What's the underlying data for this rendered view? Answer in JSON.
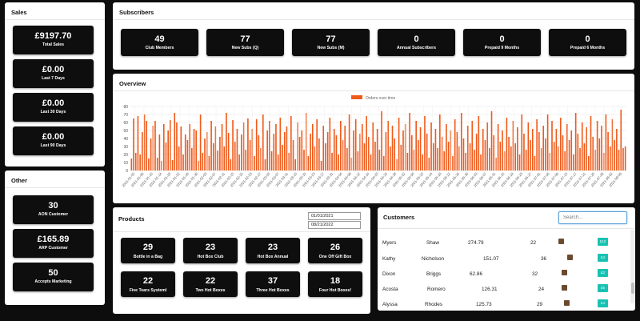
{
  "sales": {
    "title": "Sales",
    "stats": [
      {
        "value": "£9197.70",
        "label": "Total Sales"
      },
      {
        "value": "£0.00",
        "label": "Last 7 Days"
      },
      {
        "value": "£0.00",
        "label": "Last 30 Days"
      },
      {
        "value": "£0.00",
        "label": "Last 90 Days"
      }
    ]
  },
  "other": {
    "title": "Other",
    "stats": [
      {
        "value": "30",
        "label": "AON Customer"
      },
      {
        "value": "£165.89",
        "label": "ARP Customer"
      },
      {
        "value": "50",
        "label": "Accepts Marketing"
      }
    ]
  },
  "subscribers": {
    "title": "Subscribers",
    "stats": [
      {
        "value": "49",
        "label": "Club Members"
      },
      {
        "value": "77",
        "label": "New Subs (Q)"
      },
      {
        "value": "77",
        "label": "New Subs (M)"
      },
      {
        "value": "0",
        "label": "Annual Subscribers"
      },
      {
        "value": "0",
        "label": "Prepaid 9 Months"
      },
      {
        "value": "0",
        "label": "Prepaid 6 Months"
      }
    ]
  },
  "overview": {
    "title": "Overview",
    "legend_label": "Orders over time",
    "bar_color": "#f05a1a"
  },
  "chart_data": {
    "type": "bar",
    "title": "",
    "series_name": "Orders over time",
    "ylim": [
      0,
      80
    ],
    "yticks": [
      0,
      10,
      20,
      30,
      40,
      50,
      60,
      70,
      80
    ],
    "grid": true,
    "legend_position": "top-center",
    "xtick_labels": [
      "2021-01-02",
      "2021-01-06",
      "2021-01-10",
      "2021-01-14",
      "2021-01-18",
      "2021-01-22",
      "2021-01-26",
      "2021-01-30",
      "2021-02-03",
      "2021-02-07",
      "2021-02-11",
      "2021-02-15",
      "2021-02-19",
      "2021-02-23",
      "2021-02-27",
      "2021-03-03",
      "2021-03-07",
      "2021-03-11",
      "2021-03-15",
      "2021-03-19",
      "2021-03-23",
      "2021-03-27",
      "2021-03-31",
      "2021-04-04",
      "2021-04-08",
      "2021-04-12",
      "2021-04-16",
      "2021-04-20",
      "2021-04-24",
      "2021-04-28",
      "2021-05-02",
      "2021-05-06",
      "2021-05-10",
      "2021-05-14",
      "2021-05-18",
      "2021-05-22",
      "2021-05-26",
      "2021-05-30",
      "2021-06-03",
      "2021-06-07",
      "2021-06-11",
      "2021-06-15",
      "2021-06-19",
      "2021-06-23",
      "2021-06-27",
      "2021-07-01",
      "2021-07-05",
      "2021-07-09",
      "2021-07-13",
      "2021-07-17",
      "2021-07-21",
      "2021-07-25",
      "2021-07-29",
      "2021-08-02",
      "2021-08-06"
    ],
    "values": [
      15,
      65,
      22,
      68,
      20,
      48,
      70,
      62,
      15,
      40,
      56,
      62,
      16,
      45,
      12,
      58,
      35,
      50,
      63,
      13,
      72,
      60,
      30,
      55,
      20,
      45,
      38,
      58,
      28,
      52,
      50,
      12,
      70,
      22,
      40,
      48,
      18,
      62,
      34,
      55,
      25,
      42,
      58,
      30,
      72,
      47,
      14,
      63,
      36,
      52,
      20,
      45,
      60,
      26,
      65,
      38,
      52,
      18,
      64,
      44,
      28,
      70,
      14,
      50,
      62,
      24,
      46,
      58,
      20,
      66,
      32,
      48,
      55,
      22,
      68,
      38,
      14,
      60,
      42,
      50,
      26,
      72,
      18,
      46,
      58,
      30,
      64,
      40,
      12,
      56,
      34,
      48,
      66,
      22,
      52,
      44,
      20,
      62,
      38,
      56,
      28,
      70,
      16,
      50,
      64,
      24,
      46,
      58,
      34,
      68,
      42,
      20,
      60,
      36,
      52,
      26,
      74,
      18,
      48,
      62,
      30,
      56,
      40,
      14,
      66,
      32,
      50,
      58,
      22,
      72,
      44,
      26,
      62,
      38,
      54,
      20,
      68,
      46,
      16,
      60,
      34,
      52,
      28,
      70,
      42,
      24,
      58,
      36,
      50,
      18,
      64,
      48,
      30,
      72,
      40,
      22,
      56,
      34,
      62,
      26,
      46,
      68,
      20,
      52,
      38,
      60,
      28,
      74,
      44,
      16,
      58,
      36,
      50,
      24,
      66,
      42,
      30,
      62,
      34,
      54,
      20,
      70,
      46,
      26,
      60,
      38,
      52,
      18,
      64,
      48,
      28,
      56,
      40,
      70,
      22,
      62,
      36,
      52,
      30,
      66,
      44,
      24,
      58,
      38,
      50,
      20,
      72,
      46,
      28,
      60,
      34,
      54,
      18,
      68,
      42,
      26,
      62,
      40,
      56,
      22,
      70,
      48,
      30,
      64,
      38,
      52,
      26,
      76,
      28,
      30
    ],
    "bar_color": "#f05a1a"
  },
  "products": {
    "title": "Products",
    "date_from": "01/01/2021",
    "date_to": "08/21/2022",
    "stats": [
      {
        "value": "29",
        "label": "Bottle in a Bag"
      },
      {
        "value": "23",
        "label": "Hot Box Club"
      },
      {
        "value": "23",
        "label": "Hot Box Annual"
      },
      {
        "value": "26",
        "label": "One Off Gift Box"
      },
      {
        "value": "22",
        "label": "Five Tears Systeml"
      },
      {
        "value": "22",
        "label": "Two Hot Boxes"
      },
      {
        "value": "37",
        "label": "Three Hot Boxes"
      },
      {
        "value": "18",
        "label": "Four Hot Boxes!"
      }
    ]
  },
  "customers": {
    "title": "Customers",
    "search_placeholder": "Search...",
    "rows": [
      {
        "first": "Myers",
        "last": "Shaw",
        "amount": "274.79",
        "count": "22",
        "thumb": "down",
        "tag": "£12"
      },
      {
        "first": "Kathy",
        "last": "Nicholson",
        "amount": "151.07",
        "count": "36",
        "thumb": "up",
        "tag": "£4"
      },
      {
        "first": "Dixon",
        "last": "Briggs",
        "amount": "62.86",
        "count": "32",
        "thumb": "up",
        "tag": "£2"
      },
      {
        "first": "Acosta",
        "last": "Romero",
        "amount": "126.31",
        "count": "24",
        "thumb": "up",
        "tag": "£5"
      },
      {
        "first": "Alyssa",
        "last": "Rhodes",
        "amount": "125.73",
        "count": "29",
        "thumb": "down",
        "tag": "£4"
      }
    ]
  }
}
